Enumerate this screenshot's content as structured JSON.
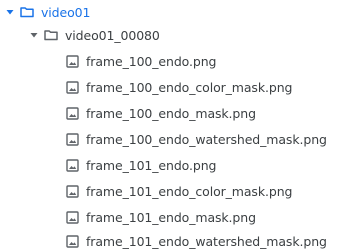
{
  "tree": {
    "root": {
      "label": "video01",
      "expanded": true,
      "icon": "folder-icon",
      "color": "#1a73e8"
    },
    "subfolder": {
      "label": "video01_00080",
      "expanded": true,
      "icon": "folder-icon"
    },
    "files": [
      {
        "label": "frame_100_endo.png",
        "icon": "image-file-icon"
      },
      {
        "label": "frame_100_endo_color_mask.png",
        "icon": "image-file-icon"
      },
      {
        "label": "frame_100_endo_mask.png",
        "icon": "image-file-icon"
      },
      {
        "label": "frame_100_endo_watershed_mask.png",
        "icon": "image-file-icon"
      },
      {
        "label": "frame_101_endo.png",
        "icon": "image-file-icon"
      },
      {
        "label": "frame_101_endo_color_mask.png",
        "icon": "image-file-icon"
      },
      {
        "label": "frame_101_endo_mask.png",
        "icon": "image-file-icon"
      },
      {
        "label": "frame_101_endo_watershed_mask.png",
        "icon": "image-file-icon"
      }
    ]
  }
}
